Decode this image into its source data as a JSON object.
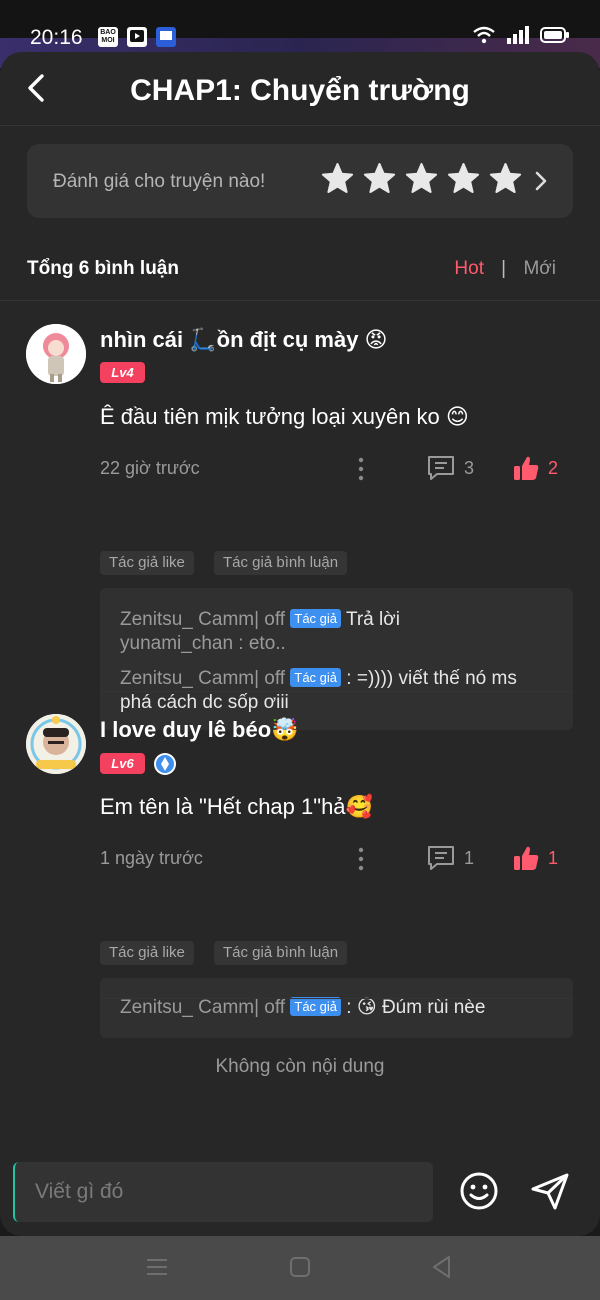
{
  "status_bar": {
    "time": "20:16",
    "app_icons": [
      "BAO MOI",
      "video-app",
      "hoc-app"
    ]
  },
  "header": {
    "title": "CHAP1: Chuyển trường"
  },
  "rating": {
    "prompt": "Đánh giá cho truyện nào!",
    "star_count": 5,
    "star_color": "#e8e8e8"
  },
  "summary": {
    "total_label": "Tổng 6 bình luận",
    "sort_hot": "Hot",
    "sort_divider": "|",
    "sort_new": "Mới",
    "active_sort": "Hot"
  },
  "comments": [
    {
      "user_name": "nhìn cái 🛴ồn địt cụ mày 😡",
      "level": "Lv4",
      "text": "Ê đầu tiên mịk tưởng loại xuyên ko 😊",
      "time": "22 giờ trước",
      "reply_count": "3",
      "like_count": "2",
      "tags": [
        "Tác giả like",
        "Tác giả bình luận"
      ],
      "replies": [
        {
          "user": "Zenitsu_ Camm| off",
          "badge": "Tác giả",
          "body_1": "Trả lời",
          "body_2": "yunami_chan : eto.."
        },
        {
          "user": "Zenitsu_ Camm| off",
          "badge": "Tác giả",
          "body_1": ": =)))) viết thế nó ms",
          "body_2": "phá cách dc sốp ơiii"
        }
      ]
    },
    {
      "user_name": "I love duy lê béo🤯",
      "level": "Lv6",
      "text": "Em tên là \"Hết chap 1\"hả🥰",
      "time": "1 ngày trước",
      "reply_count": "1",
      "like_count": "1",
      "tags": [
        "Tác giả like",
        "Tác giả bình luận"
      ],
      "replies": [
        {
          "user": "Zenitsu_ Camm| off",
          "badge": "Tác giả",
          "body_1": ": 😘 Đúm rùi nèe"
        }
      ]
    }
  ],
  "end_text": "Không còn nội dung",
  "input": {
    "placeholder": "Viết gì đó"
  },
  "colors": {
    "accent": "#ff5a6e",
    "level_badge": "#f4415f",
    "author_badge": "#3d8ff0",
    "background": "#272727"
  }
}
